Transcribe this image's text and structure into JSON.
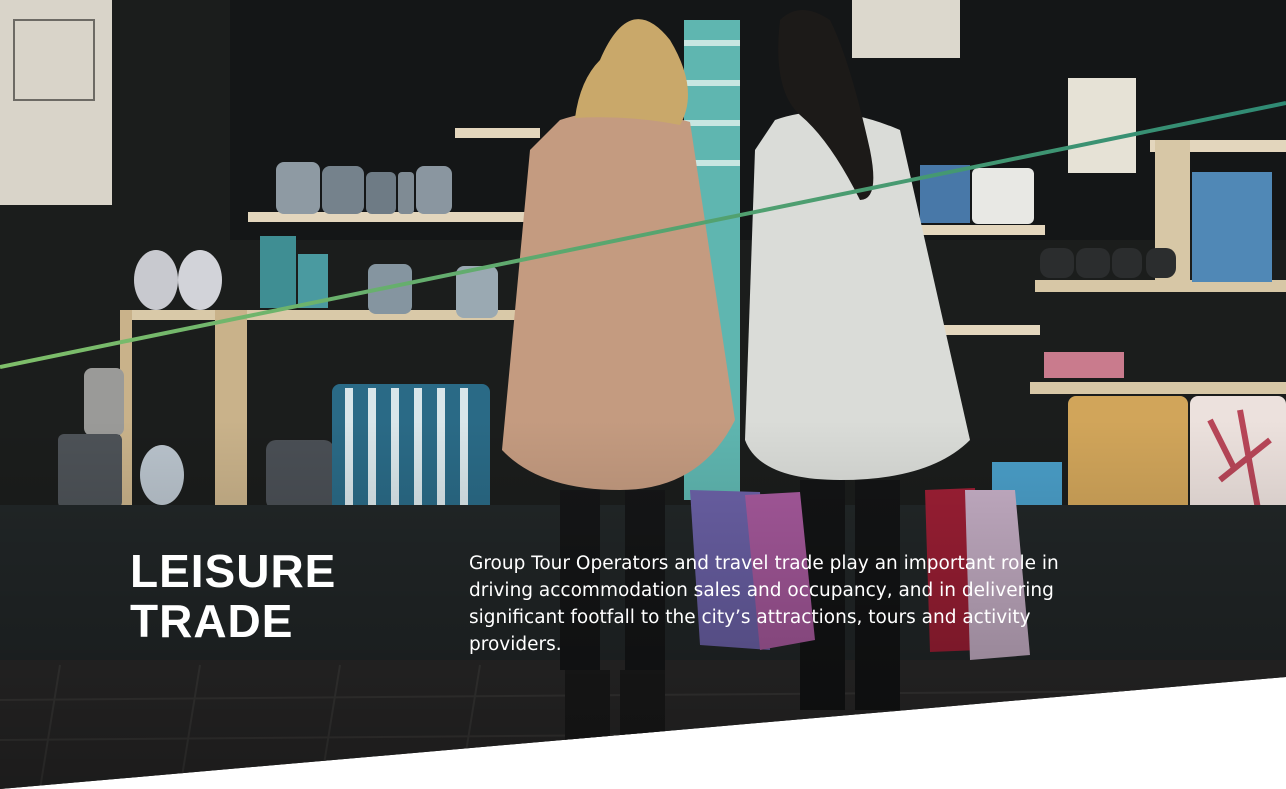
{
  "hero": {
    "title_line1": "LEISURE",
    "title_line2": "TRADE",
    "description": "Group Tour Operators and travel trade play an important role in driving accommodation sales and occupancy, and in delivering significant footfall to the city’s attractions, tours and activity providers."
  },
  "colors": {
    "background": "#ffffff",
    "text": "#ffffff",
    "accent_line_teal": "#2f8a74",
    "accent_line_green": "#7fbf6a"
  },
  "image": {
    "subject": "Two women with shopping bags looking into a homeware shop window at night"
  }
}
